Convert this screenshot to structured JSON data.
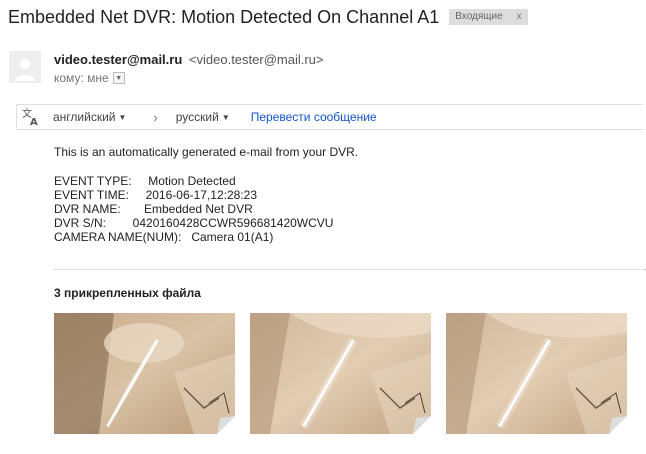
{
  "subject": "Embedded Net DVR: Motion Detected On Channel A1",
  "label_chip": {
    "text": "Входящие",
    "close": "x"
  },
  "sender": {
    "name": "video.tester@mail.ru",
    "email": "<video.tester@mail.ru>"
  },
  "recipient": {
    "text": "кому: мне"
  },
  "translate": {
    "from_lang": "английский",
    "arrow": "›",
    "to_lang": "русский",
    "action": "Перевести сообщение"
  },
  "body": {
    "intro": "This is an automatically generated e-mail from your DVR.",
    "lines": [
      "EVENT TYPE:     Motion Detected",
      "EVENT TIME:     2016-06-17,12:28:23",
      "DVR NAME:       Embedded Net DVR",
      "DVR S/N:        0420160428CCWR596681420WCVU",
      "CAMERA NAME(NUM):   Camera 01(A1)"
    ]
  },
  "attachments": {
    "title": "3 прикрепленных файла",
    "items": [
      {
        "icon": "image-thumbnail"
      },
      {
        "icon": "image-thumbnail"
      },
      {
        "icon": "image-thumbnail"
      }
    ]
  },
  "colors": {
    "link": "#1155cc",
    "chip_bg": "#dddddd",
    "text": "#222222"
  }
}
